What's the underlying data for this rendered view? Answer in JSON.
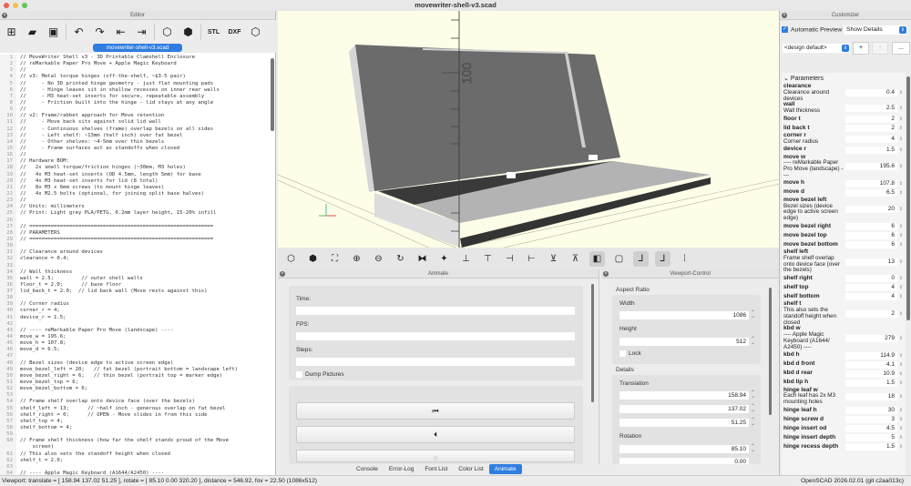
{
  "window": {
    "title": "movewriter-shell-v3.scad"
  },
  "editor": {
    "title": "Editor",
    "file_tab": "movewriter-shell-v3.scad",
    "lines": [
      "// MoveWriter Shell v3 - 3D Printable Clamshell Enclosure",
      "// reMarkable Paper Pro Move + Apple Magic Keyboard",
      "//",
      "// v3: Metal torque hinges (off-the-shelf, ~$3-5 pair)",
      "//     - No 3D printed hinge geometry - just flat mounting pads",
      "//     - Hinge leaves sit in shallow recesses on inner rear walls",
      "//     - M3 heat-set inserts for secure, repeatable assembly",
      "//     - Friction built into the hinge - lid stays at any angle",
      "//",
      "// v2: Frame/rabbet approach for Move retention",
      "//     - Move back sits against solid lid wall",
      "//     - Continuous shelves (frame) overlap bezels on all sides",
      "//     - Left shelf: ~13mm (half inch) over fat bezel",
      "//     - Other shelves: ~4-5mm over thin bezels",
      "//     - Frame surfaces act as standoffs when closed",
      "//",
      "// Hardware BOM:",
      "//   2x small torque/friction hinges (~30mm, M3 holes)",
      "//   4x M3 heat-set inserts (OD 4.5mm, length 5mm) for base",
      "//   4x M3 heat-set inserts for lid (8 total)",
      "//   8x M3 x 6mm screws (to mount hinge leaves)",
      "//   4x M2.5 bolts (optional, for joining split base halves)",
      "//",
      "// Units: millimeters",
      "// Print: Light grey PLA/PETG, 0.2mm layer height, 15-20% infill",
      "",
      "// ============================================================",
      "// PARAMETERS",
      "// ============================================================",
      "",
      "// Clearance around devices",
      "clearance = 0.4;",
      "",
      "// Wall thickness",
      "wall = 2.5;         // outer shell walls",
      "floor_t = 2.0;      // base floor",
      "lid_back_t = 2.0;  // lid back wall (Move rests against this)",
      "",
      "// Corner radius",
      "corner_r = 4;",
      "device_r = 1.5;",
      "",
      "// ---- reMarkable Paper Pro Move (landscape) ----",
      "move_w = 195.6;",
      "move_h = 107.8;",
      "move_d = 6.5;",
      "",
      "// Bezel sizes (device edge to active screen edge)",
      "move_bezel_left = 20;   // fat bezel (portrait bottom = landscape left)",
      "move_bezel_right = 6;   // thin bezel (portrait top = marker edge)",
      "move_bezel_top = 6;",
      "move_bezel_bottom = 6;",
      "",
      "// Frame shelf overlap onto device face (over the bezels)",
      "shelf_left = 13;      // ~half inch - generous overlap on fat bezel",
      "shelf_right = 0;      // OPEN - Move slides in from this side",
      "shelf_top = 4;",
      "shelf_bottom = 4;",
      "",
      "// Frame shelf thickness (how far the shelf stands proud of the Move",
      "    screen)",
      "// This also sets the standoff height when closed",
      "shelf_t = 2.0;",
      "",
      "// ---- Apple Magic Keyboard (A1644/A2450) ----"
    ]
  },
  "view": {
    "axis_label": "100"
  },
  "animate": {
    "title": "Animate",
    "time_label": "Time:",
    "fps_label": "FPS:",
    "steps_label": "Steps:",
    "dump_label": "Dump Pictures",
    "time": "",
    "fps": "",
    "steps": ""
  },
  "viewport_control": {
    "title": "Viewport-Control",
    "aspect_label": "Aspect Ratio",
    "width_label": "Width",
    "width": "1086",
    "height_label": "Height",
    "height": "512",
    "lock_label": "Lock",
    "details_label": "Details",
    "translation_label": "Translation",
    "tx": "158.94",
    "ty": "137.02",
    "tz": "51.25",
    "rotation_label": "Rotation",
    "rx": "85.10",
    "ry": "0.00"
  },
  "bottom_tabs": [
    "Console",
    "Error-Log",
    "Font List",
    "Color List",
    "Animate"
  ],
  "status": {
    "text": "Viewport: translate = [ 158.94 137.02 51.25 ], rotate = [ 85.10 0.00 320.20 ], distance = 546.92, fov = 22.50 (1086x512)",
    "version": "OpenSCAD 2026.02.01 (git c2aa013c)"
  },
  "customizer": {
    "title": "Customizer",
    "auto_preview": "Automatic Preview",
    "details_select": "Show Details",
    "preset": "<design default>",
    "add": "+",
    "remove": "-",
    "more": "...",
    "section": "Parameters",
    "params": [
      {
        "name": "clearance",
        "desc": "Clearance around devices",
        "value": "0.4"
      },
      {
        "name": "wall",
        "desc": "Wall thickness",
        "value": "2.5"
      },
      {
        "name": "floor t",
        "desc": "",
        "value": "2"
      },
      {
        "name": "lid back t",
        "desc": "",
        "value": "2"
      },
      {
        "name": "corner r",
        "desc": "Corner radius",
        "value": "4"
      },
      {
        "name": "device r",
        "desc": "",
        "value": "1.5"
      },
      {
        "name": "move w",
        "desc": "---- reMarkable Paper Pro Move (landscape) ----",
        "value": "195.6"
      },
      {
        "name": "move h",
        "desc": "",
        "value": "107.8"
      },
      {
        "name": "move d",
        "desc": "",
        "value": "6.5"
      },
      {
        "name": "move bezel left",
        "desc": "Bezel sizes (device edge to active screen edge)",
        "value": "20"
      },
      {
        "name": "move bezel right",
        "desc": "",
        "value": "6"
      },
      {
        "name": "move bezel top",
        "desc": "",
        "value": "6"
      },
      {
        "name": "move bezel bottom",
        "desc": "",
        "value": "6"
      },
      {
        "name": "shelf left",
        "desc": "Frame shelf overlap onto device face (over the bezels)",
        "value": "13"
      },
      {
        "name": "shelf right",
        "desc": "",
        "value": "0"
      },
      {
        "name": "shelf top",
        "desc": "",
        "value": "4"
      },
      {
        "name": "shelf bottom",
        "desc": "",
        "value": "4"
      },
      {
        "name": "shelf t",
        "desc": "This also sets the standoff height when closed",
        "value": "2"
      },
      {
        "name": "kbd w",
        "desc": "---- Apple Magic Keyboard (A1644/ A2450) ----",
        "value": "279"
      },
      {
        "name": "kbd h",
        "desc": "",
        "value": "114.9"
      },
      {
        "name": "kbd d front",
        "desc": "",
        "value": "4.1"
      },
      {
        "name": "kbd d rear",
        "desc": "",
        "value": "10.9"
      },
      {
        "name": "kbd lip h",
        "desc": "",
        "value": "1.5"
      },
      {
        "name": "hinge leaf w",
        "desc": "Each leaf has 2x M3 mounting holes",
        "value": "18"
      },
      {
        "name": "hinge leaf h",
        "desc": "",
        "value": "30"
      },
      {
        "name": "hinge screw d",
        "desc": "",
        "value": "3"
      },
      {
        "name": "hinge insert od",
        "desc": "",
        "value": "4.5"
      },
      {
        "name": "hinge insert depth",
        "desc": "",
        "value": "5"
      },
      {
        "name": "hinge recess depth",
        "desc": "",
        "value": "1.5"
      }
    ]
  }
}
